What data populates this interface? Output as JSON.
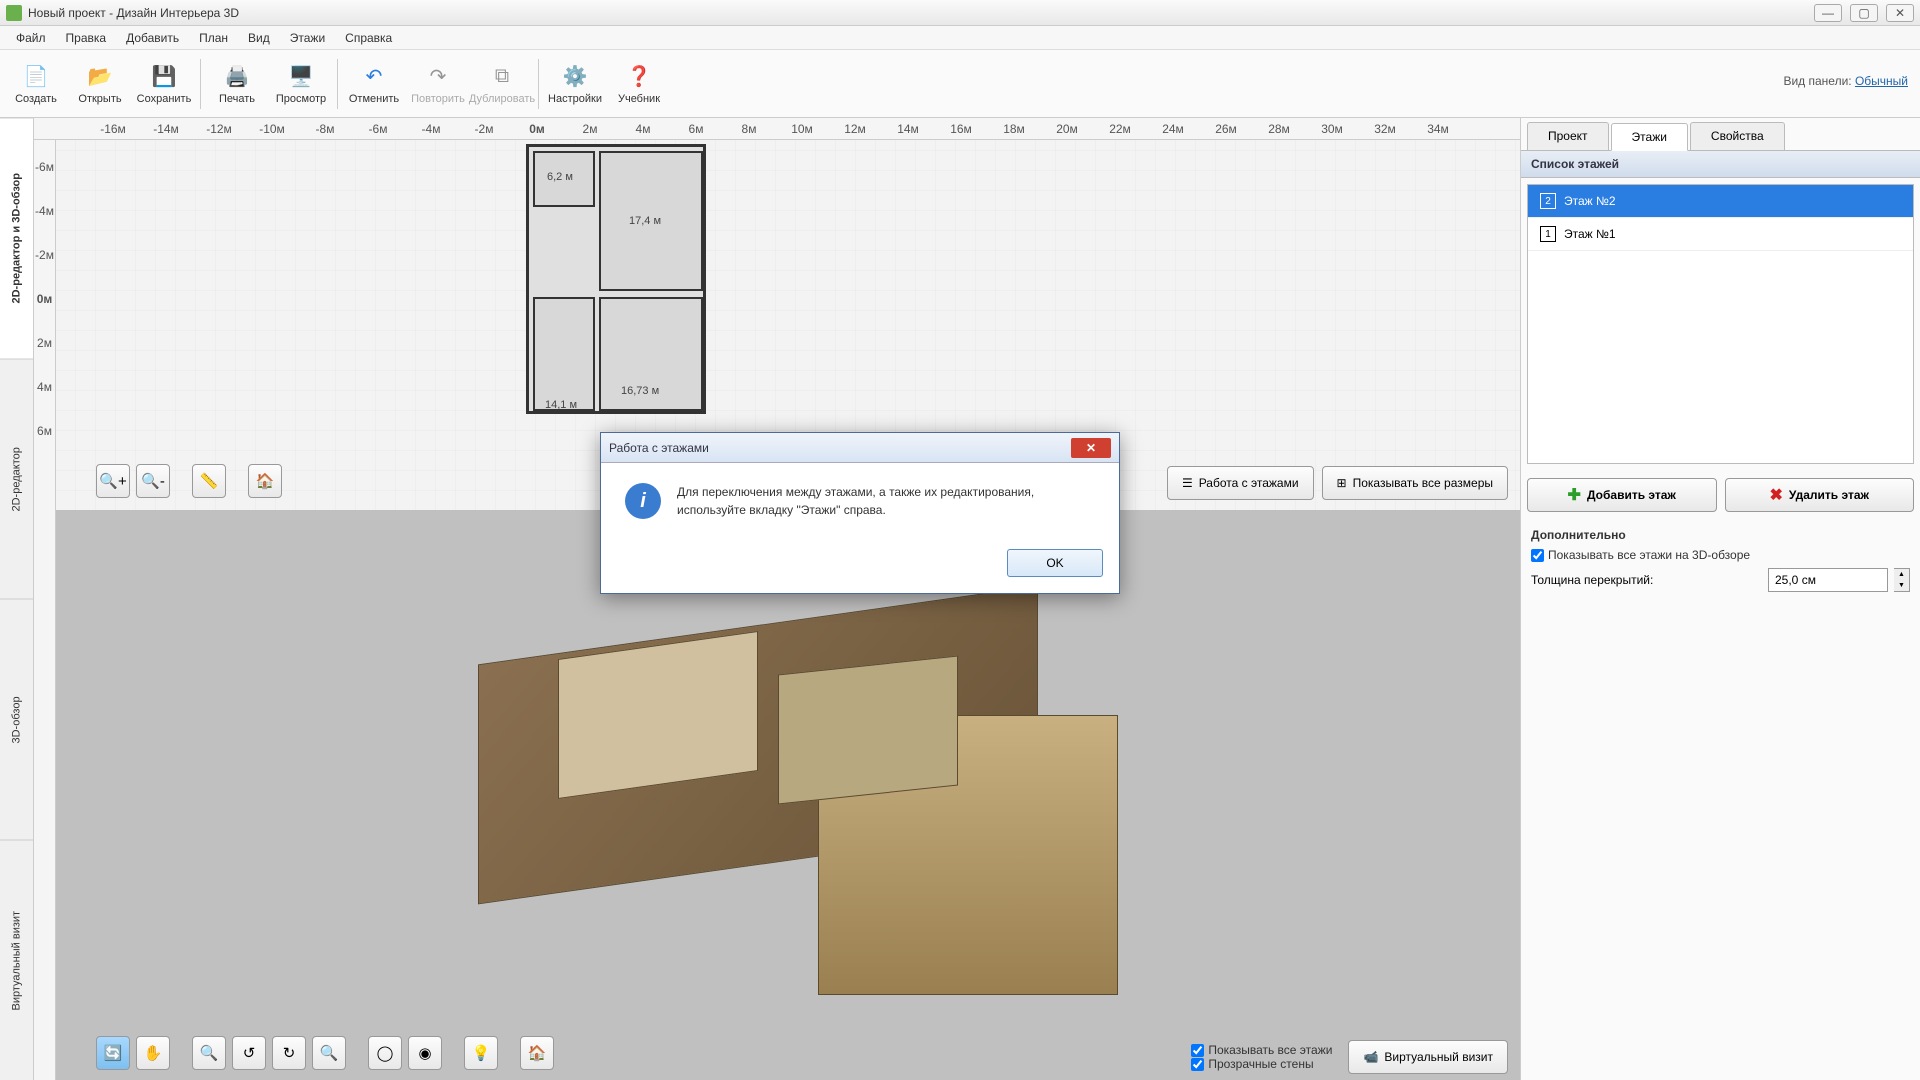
{
  "titlebar": {
    "title": "Новый проект - Дизайн Интерьера 3D"
  },
  "menu": {
    "file": "Файл",
    "edit": "Правка",
    "add": "Добавить",
    "plan": "План",
    "view": "Вид",
    "floors": "Этажи",
    "help": "Справка"
  },
  "toolbar": {
    "create": "Создать",
    "open": "Открыть",
    "save": "Сохранить",
    "print": "Печать",
    "preview": "Просмотр",
    "undo": "Отменить",
    "redo": "Повторить",
    "duplicate": "Дублировать",
    "settings": "Настройки",
    "tutorial": "Учебник",
    "panel_mode_label": "Вид панели:",
    "panel_mode_value": "Обычный"
  },
  "left_tabs": {
    "combo": "2D-редактор и 3D-обзор",
    "edit2d": "2D-редактор",
    "view3d": "3D-обзор",
    "virtual": "Виртуальный визит"
  },
  "ruler_h": [
    "-16м",
    "-14м",
    "-12м",
    "-10м",
    "-8м",
    "-6м",
    "-4м",
    "-2м",
    "0м",
    "2м",
    "4м",
    "6м",
    "8м",
    "10м",
    "12м",
    "14м",
    "16м",
    "18м",
    "20м",
    "22м",
    "24м",
    "26м",
    "28м",
    "30м",
    "32м",
    "34м"
  ],
  "ruler_v": [
    "-6м",
    "-4м",
    "-2м",
    "0м",
    "2м",
    "4м",
    "6м"
  ],
  "floorplan": {
    "r1": "6,2 м",
    "r2": "17,4 м",
    "r3": "14,1 м",
    "r4": "16,73 м"
  },
  "view2d_right": {
    "floors_btn": "Работа с этажами",
    "dims_btn": "Показывать все размеры"
  },
  "view3d_checks": {
    "all_floors": "Показывать все этажи",
    "transparent": "Прозрачные стены",
    "virtual": "Виртуальный визит"
  },
  "right_panel": {
    "tabs": {
      "project": "Проект",
      "floors": "Этажи",
      "props": "Свойства"
    },
    "list_header": "Список этажей",
    "floors": [
      "Этаж №2",
      "Этаж №1"
    ],
    "add_btn": "Добавить этаж",
    "del_btn": "Удалить этаж",
    "extra_header": "Дополнительно",
    "show_all_3d": "Показывать все этажи на 3D-обзоре",
    "thickness_label": "Толщина перекрытий:",
    "thickness_value": "25,0 см"
  },
  "dialog": {
    "title": "Работа с этажами",
    "message": "Для переключения между этажами, а также их редактирования, используйте вкладку \"Этажи\" справа.",
    "ok": "OK"
  }
}
